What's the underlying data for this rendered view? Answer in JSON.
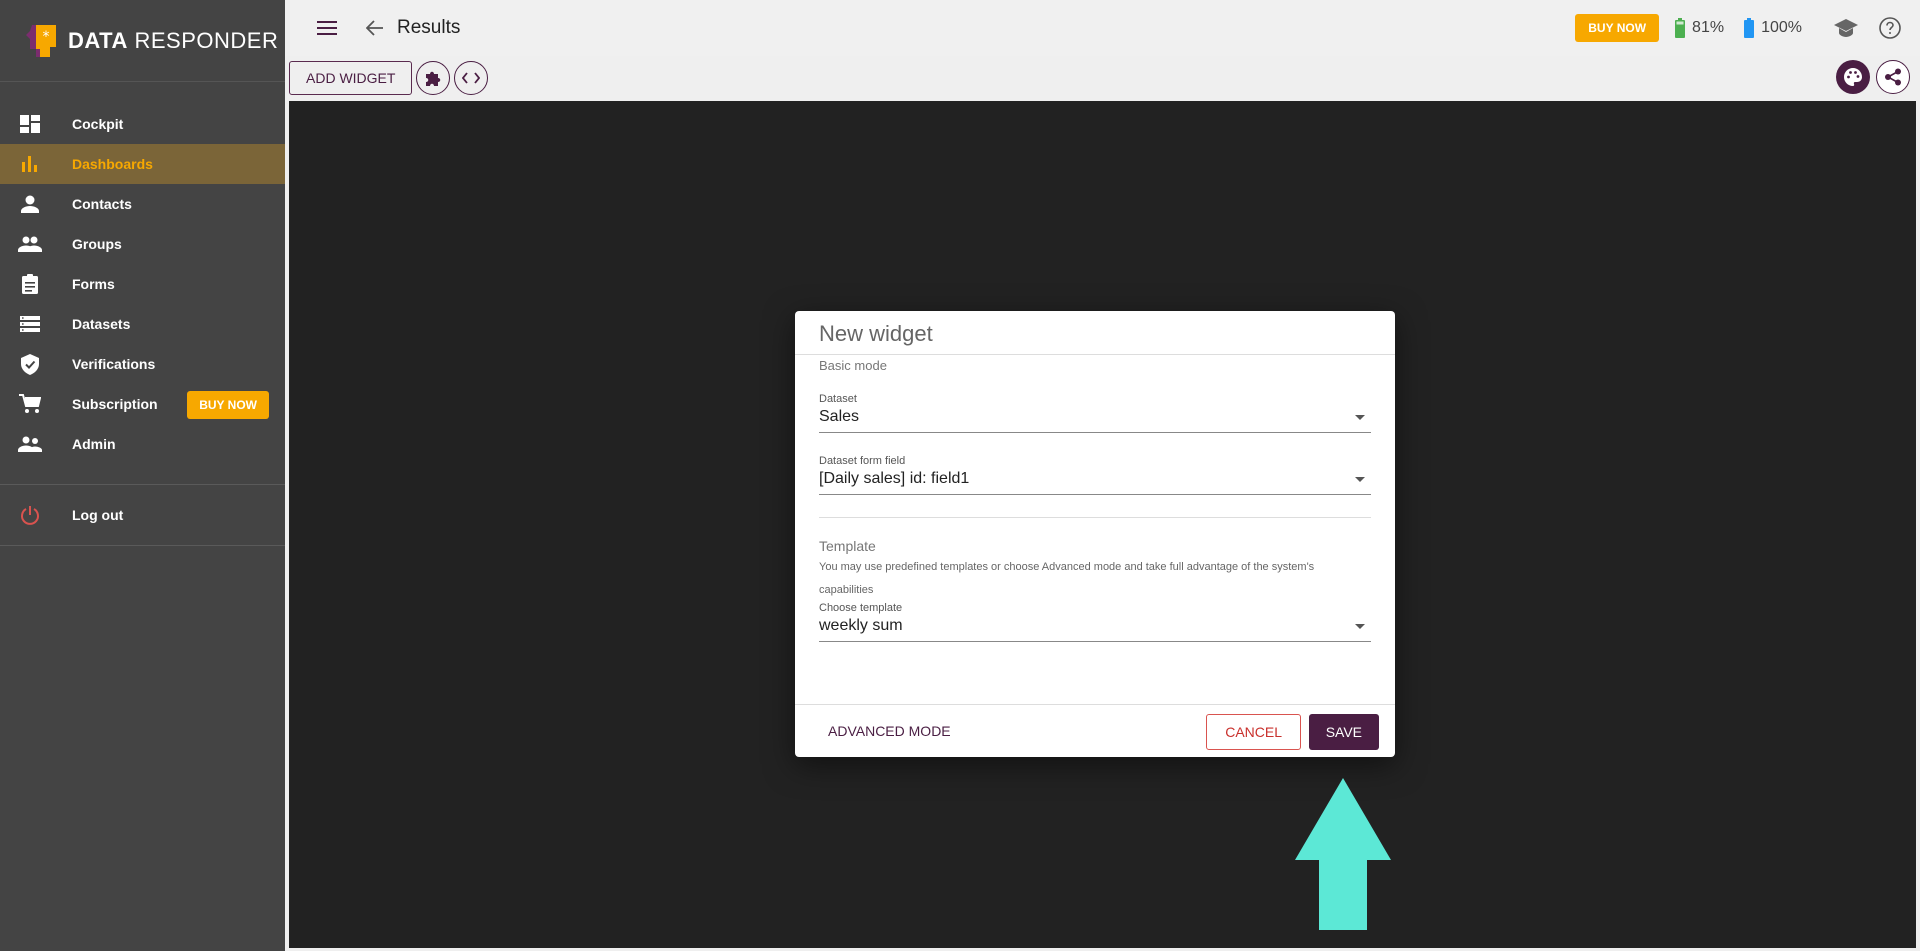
{
  "brand": {
    "name_bold": "DATA",
    "name_light": "RESPONDER"
  },
  "sidebar": {
    "items": [
      {
        "label": "Cockpit",
        "icon": "dashboard-icon"
      },
      {
        "label": "Dashboards",
        "icon": "bar-chart-icon",
        "active": true
      },
      {
        "label": "Contacts",
        "icon": "person-icon"
      },
      {
        "label": "Groups",
        "icon": "people-icon"
      },
      {
        "label": "Forms",
        "icon": "clipboard-icon"
      },
      {
        "label": "Datasets",
        "icon": "storage-icon"
      },
      {
        "label": "Verifications",
        "icon": "shield-check-icon"
      },
      {
        "label": "Subscription",
        "icon": "cart-icon"
      },
      {
        "label": "Admin",
        "icon": "admin-people-icon"
      }
    ],
    "buy_now": "BUY NOW",
    "logout": "Log out"
  },
  "topbar": {
    "title": "Results",
    "buy_now": "BUY NOW",
    "battery_green": "81%",
    "battery_blue": "100%"
  },
  "toolbar": {
    "add_widget": "ADD WIDGET"
  },
  "dialog": {
    "title": "New widget",
    "mode": "Basic mode",
    "dataset_label": "Dataset",
    "dataset_value": "Sales",
    "form_field_label": "Dataset form field",
    "form_field_value": "[Daily sales] id: field1",
    "template_title": "Template",
    "template_desc": "You may use predefined templates or choose Advanced mode and take full advantage of the system's capabilities",
    "choose_template_label": "Choose template",
    "choose_template_value": "weekly sum",
    "advanced_mode": "ADVANCED MODE",
    "cancel": "CANCEL",
    "save": "SAVE"
  },
  "colors": {
    "accent": "#4a1e43",
    "buy": "#f7a800",
    "sidebar": "#444444",
    "arrow": "#5ce8d6"
  }
}
